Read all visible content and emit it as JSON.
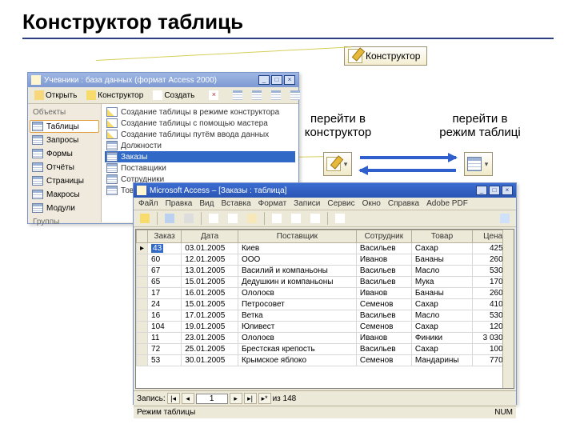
{
  "title": "Конструктор таблиць",
  "konstr_button": "Конструктор",
  "labels": {
    "to_designer_1": "перейти в",
    "to_designer_2": "конструктор",
    "to_table_1": "перейти в",
    "to_table_2": "режим таблиці"
  },
  "db_window": {
    "title": "Учевники : база данных (формат Access 2000)",
    "toolbar": {
      "open": "Открыть",
      "designer": "Конструктор",
      "create": "Создать"
    },
    "sidebar": {
      "heading1": "Объекты",
      "heading2": "Группы",
      "items": [
        "Таблицы",
        "Запросы",
        "Формы",
        "Отчёты",
        "Страницы",
        "Макросы",
        "Модули"
      ]
    },
    "objects": [
      "Создание таблицы в режиме конструктора",
      "Создание таблицы с помощью мастера",
      "Создание таблицы путём ввода данных",
      "Должности",
      "Заказы",
      "Поставщики",
      "Сотрудники",
      "Товары"
    ],
    "selected": "Заказы"
  },
  "table_window": {
    "app_title": "Microsoft Access – [Заказы : таблица]",
    "menu": [
      "Файл",
      "Правка",
      "Вид",
      "Вставка",
      "Формат",
      "Записи",
      "Сервис",
      "Окно",
      "Справка",
      "Adobe PDF"
    ],
    "columns": [
      "Заказ",
      "Дата",
      "Поставщик",
      "Сотрудник",
      "Товар",
      "Цена"
    ],
    "rows": [
      {
        "id": "43",
        "date": "03.01.2005",
        "sup": "Киев",
        "emp": "Васильев",
        "prod": "Сахар",
        "price": "425р."
      },
      {
        "id": "60",
        "date": "12.01.2005",
        "sup": "ООО",
        "emp": "Иванов",
        "prod": "Бананы",
        "price": "260р."
      },
      {
        "id": "67",
        "date": "13.01.2005",
        "sup": "Василий и компаньоны",
        "emp": "Васильев",
        "prod": "Масло",
        "price": "530р."
      },
      {
        "id": "65",
        "date": "15.01.2005",
        "sup": "Дедушкин и компаньоны",
        "emp": "Васильев",
        "prod": "Мука",
        "price": "170р."
      },
      {
        "id": "17",
        "date": "16.01.2005",
        "sup": "Ололоєв",
        "emp": "Иванов",
        "prod": "Бананы",
        "price": "260р."
      },
      {
        "id": "24",
        "date": "15.01.2005",
        "sup": "Петросовет",
        "emp": "Семенов",
        "prod": "Сахар",
        "price": "410р."
      },
      {
        "id": "16",
        "date": "17.01.2005",
        "sup": "Ветка",
        "emp": "Васильев",
        "prod": "Масло",
        "price": "530р."
      },
      {
        "id": "104",
        "date": "19.01.2005",
        "sup": "Юливест",
        "emp": "Семенов",
        "prod": "Сахар",
        "price": "120р."
      },
      {
        "id": "11",
        "date": "23.01.2005",
        "sup": "Ололоєв",
        "emp": "Иванов",
        "prod": "Финики",
        "price": "3 030р."
      },
      {
        "id": "72",
        "date": "25.01.2005",
        "sup": "Брестская крепость",
        "emp": "Васильев",
        "prod": "Сахар",
        "price": "100р."
      },
      {
        "id": "53",
        "date": "30.01.2005",
        "sup": "Крымское яблоко",
        "emp": "Семенов",
        "prod": "Мандарины",
        "price": "770р."
      }
    ],
    "nav": {
      "label": "Запись:",
      "current": "1",
      "total": "из 148"
    },
    "status": {
      "mode": "Режим таблицы",
      "num": "NUM"
    }
  }
}
